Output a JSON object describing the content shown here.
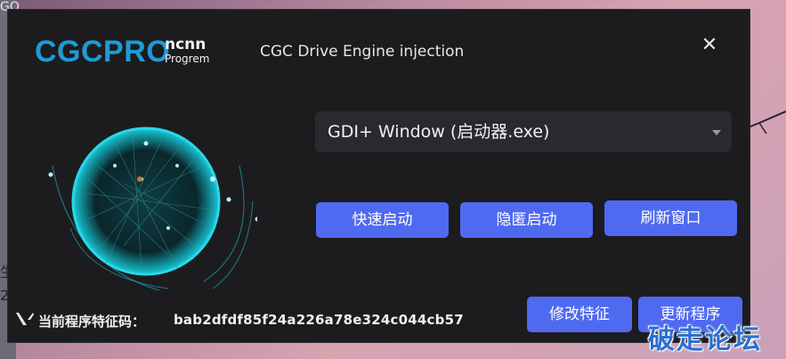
{
  "background": {
    "left_text_1": "GO",
    "left_text_2": "生",
    "left_text_3": "2"
  },
  "window": {
    "logo": "CGCPRO",
    "logo_sub_top": "ncnn",
    "logo_sub_bottom": "Progrem",
    "title": "CGC Drive Engine injection",
    "close_symbol": "✕"
  },
  "process_select": {
    "value": "GDI+ Window (启动器.exe)"
  },
  "buttons": {
    "quick_start": "快速启动",
    "hidden_start": "隐匿启动",
    "refresh_window": "刷新窗口",
    "modify_signature": "修改特征",
    "update_program": "更新程序"
  },
  "footer": {
    "label": "当前程序特征码：",
    "code": "bab2dfdf85f24a226a78e324c044cb57"
  },
  "watermark": "破走论坛",
  "colors": {
    "accent": "#4f6af0",
    "logo": "#1e9bd7",
    "window_bg": "#1c1c1e",
    "globe_glow": "#2ad7e8"
  }
}
